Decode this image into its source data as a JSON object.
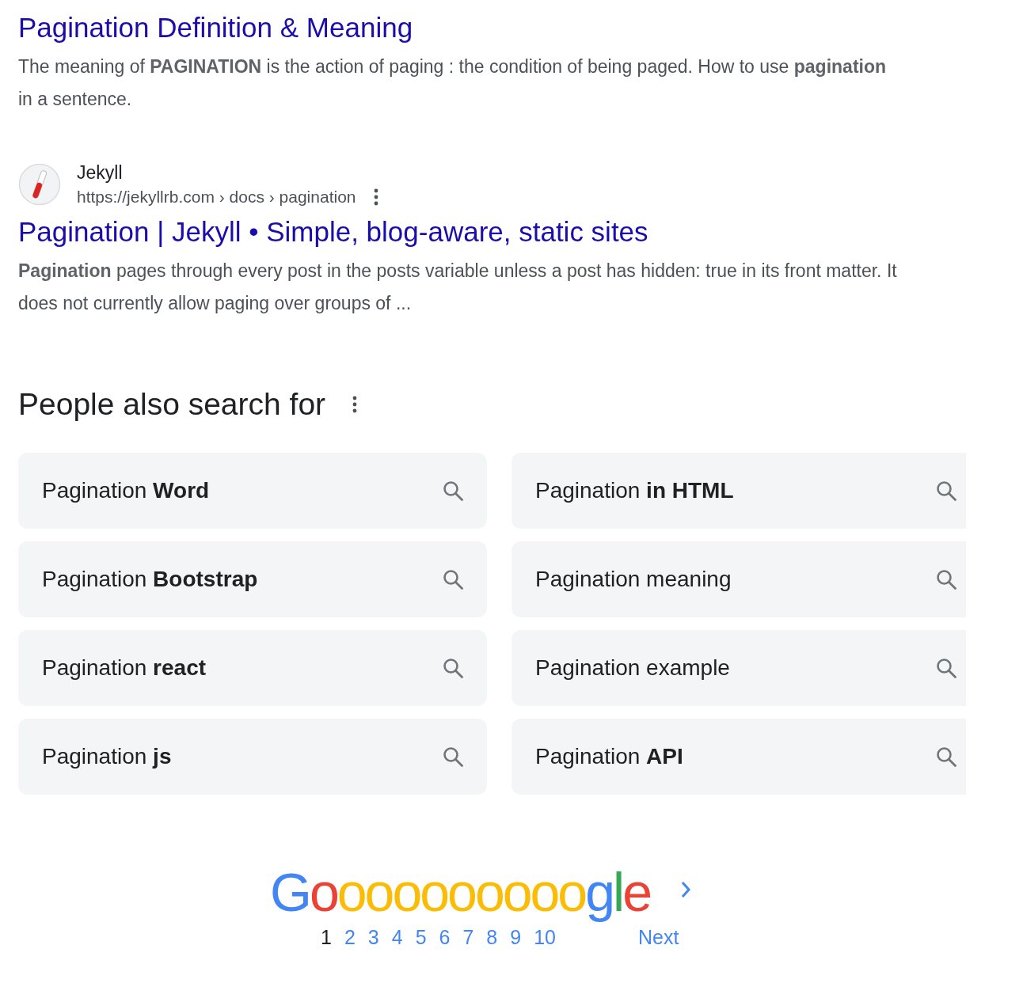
{
  "results": [
    {
      "title": "Pagination Definition & Meaning",
      "snippet": "The meaning of **PAGINATION** is the action of paging : the condition of being paged. How to use **pagination** in a sentence."
    },
    {
      "site": "Jekyll",
      "url": "https://jekyllrb.com › docs › pagination",
      "title": "Pagination | Jekyll • Simple, blog-aware, static sites",
      "snippet": "**Pagination** pages through every post in the posts variable unless a post has hidden: true in its front matter. It does not currently allow paging over groups of ..."
    }
  ],
  "related": {
    "heading": "People also search for",
    "items": [
      "Pagination **Word**",
      "Pagination **in HTML**",
      "Pagination **Bootstrap**",
      "Pagination meaning",
      "Pagination **react**",
      "Pagination example",
      "Pagination **js**",
      "Pagination **API**"
    ]
  },
  "pager": {
    "logo": [
      {
        "text": "G",
        "color": "#4285f4"
      },
      {
        "text": "o",
        "color": "#ea4335"
      },
      {
        "text": "o",
        "color": "#fbbc05"
      },
      {
        "text": "o",
        "color": "#fbbc05"
      },
      {
        "text": "o",
        "color": "#fbbc05"
      },
      {
        "text": "o",
        "color": "#fbbc05"
      },
      {
        "text": "o",
        "color": "#fbbc05"
      },
      {
        "text": "o",
        "color": "#fbbc05"
      },
      {
        "text": "o",
        "color": "#fbbc05"
      },
      {
        "text": "o",
        "color": "#fbbc05"
      },
      {
        "text": "o",
        "color": "#fbbc05"
      },
      {
        "text": "g",
        "color": "#4285f4"
      },
      {
        "text": "l",
        "color": "#34a853"
      },
      {
        "text": "e",
        "color": "#ea4335"
      }
    ],
    "pages": [
      {
        "label": "1",
        "selected": true
      },
      {
        "label": "2",
        "selected": false
      },
      {
        "label": "3",
        "selected": false
      },
      {
        "label": "4",
        "selected": false
      },
      {
        "label": "5",
        "selected": false
      },
      {
        "label": "6",
        "selected": false
      },
      {
        "label": "7",
        "selected": false
      },
      {
        "label": "8",
        "selected": false
      },
      {
        "label": "9",
        "selected": false
      },
      {
        "label": "10",
        "selected": false
      }
    ],
    "next": "Next"
  }
}
